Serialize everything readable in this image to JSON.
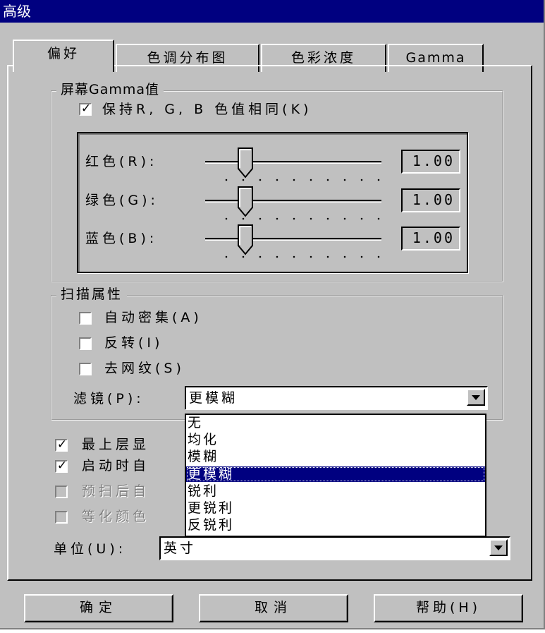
{
  "window": {
    "title": "高级"
  },
  "tabs": [
    {
      "label": "偏好",
      "active": true
    },
    {
      "label": "色调分布图",
      "active": false
    },
    {
      "label": "色彩浓度",
      "active": false
    },
    {
      "label": "Gamma",
      "active": false
    }
  ],
  "gamma_group": {
    "title": "屏幕Gamma值",
    "keep_same_label": "保持R, G, B 色值相同(K)",
    "keep_same_checked": true,
    "channels": [
      {
        "label": "红色(R):",
        "value": "1.00"
      },
      {
        "label": "绿色(G):",
        "value": "1.00"
      },
      {
        "label": "蓝色(B):",
        "value": "1.00"
      }
    ]
  },
  "scan_group": {
    "title": "扫描属性",
    "options": [
      {
        "label": "自动密集(A)",
        "checked": false
      },
      {
        "label": "反转(I)",
        "checked": false
      },
      {
        "label": "去网纹(S)",
        "checked": false
      }
    ],
    "filter_label": "滤镜(P):",
    "filter_value": "更模糊",
    "filter_options": [
      "无",
      "均化",
      "模糊",
      "更模糊",
      "锐利",
      "更锐利",
      "反锐利"
    ],
    "filter_selected": "更模糊"
  },
  "misc_options": [
    {
      "label": "最上层显",
      "checked": true,
      "disabled": false
    },
    {
      "label": "启动时自",
      "checked": true,
      "disabled": false
    },
    {
      "label": "预扫后自",
      "checked": false,
      "disabled": true
    },
    {
      "label": "等化颜色",
      "checked": false,
      "disabled": true
    }
  ],
  "unit": {
    "label": "单位(U):",
    "value": "英寸"
  },
  "buttons": {
    "ok": "确定",
    "cancel": "取消",
    "help": "帮助(H)"
  },
  "icons": {
    "check": "checkmark-icon",
    "dropdown": "chevron-down-icon"
  },
  "colors": {
    "titlebar": "#000080",
    "face": "#c0c0c0",
    "selection": "#000080"
  }
}
